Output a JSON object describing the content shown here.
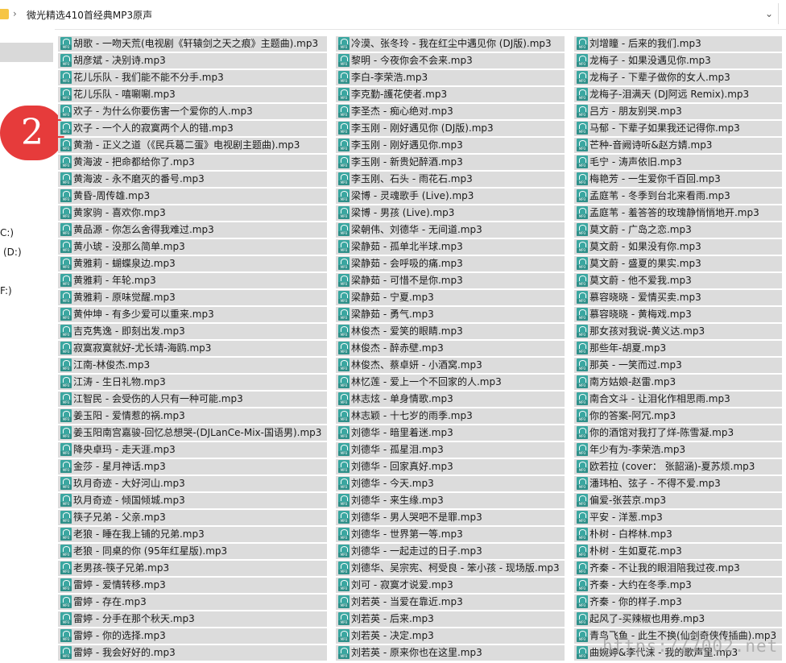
{
  "address": {
    "separator": "›",
    "path": "微光精选410首经典MP3原声",
    "dropdown": "⌄"
  },
  "nav": {
    "drives": [
      "C:)",
      "(D:)",
      "F:)"
    ]
  },
  "badge": "2",
  "file_type_label": "MP3",
  "columns": [
    [
      "胡歌 - 一吻天荒(电视剧《轩辕剑之天之痕》主题曲).mp3",
      "胡彦斌 - 决别诗.mp3",
      "花儿乐队 - 我们能不能不分手.mp3",
      "花儿乐队 - 嘻唰唰.mp3",
      "欢子 - 为什么你要伤害一个爱你的人.mp3",
      "欢子 - 一个人的寂寞两个人的错.mp3",
      "黄渤 - 正义之道（《民兵葛二蛋》电视剧主题曲).mp3",
      "黄海波 - 把命都给你了.mp3",
      "黄海波 - 永不磨灭的番号.mp3",
      "黄昏-周传雄.mp3",
      "黄家驹 - 喜欢你.mp3",
      "黄品源 - 你怎么舍得我难过.mp3",
      "黄小琥 - 没那么简单.mp3",
      "黄雅莉 - 蝴蝶泉边.mp3",
      "黄雅莉 - 年轮.mp3",
      "黄雅莉 - 原味觉醒.mp3",
      "黄仲坤 - 有多少爱可以重来.mp3",
      "吉克隽逸 - 即刻出发.mp3",
      "寂寞寂寞就好-尤长靖-海鸥.mp3",
      "江南-林俊杰.mp3",
      "江涛 - 生日礼物.mp3",
      "江智民 - 会受伤的人只有一种可能.mp3",
      "姜玉阳 - 爱情惹的祸.mp3",
      "姜玉阳南宫嘉骏-回忆总想哭-(DJLanCe-Mix-国语男).mp3",
      "降央卓玛 - 走天涯.mp3",
      "金莎 - 星月神话.mp3",
      "玖月奇迹 - 大好河山.mp3",
      "玖月奇迹 - 倾国倾城.mp3",
      "筷子兄弟 - 父亲.mp3",
      "老狼 - 睡在我上铺的兄弟.mp3",
      "老狼 - 同桌的你 (95年红星版).mp3",
      "老男孩-筷子兄弟.mp3",
      "雷婷 - 爱情转移.mp3",
      "雷婷 - 存在.mp3",
      "雷婷 - 分手在那个秋天.mp3",
      "雷婷 - 你的选择.mp3",
      "雷婷 - 我会好好的.mp3"
    ],
    [
      "冷漠、张冬玲 - 我在红尘中遇见你 (DJ版).mp3",
      "黎明 - 今夜你会不会来.mp3",
      "李白-李荣浩.mp3",
      "李克勤-護花使者.mp3",
      "李圣杰 - 痴心绝对.mp3",
      "李玉刚 - 刚好遇见你 (DJ版).mp3",
      "李玉刚 - 刚好遇见你.mp3",
      "李玉刚 - 新贵妃醉酒.mp3",
      "李玉刚、石头 - 雨花石.mp3",
      "梁博 - 灵魂歌手 (Live).mp3",
      "梁博 - 男孩 (Live).mp3",
      "梁朝伟、刘德华 - 无间道.mp3",
      "梁静茹 - 孤单北半球.mp3",
      "梁静茹 - 会呼吸的痛.mp3",
      "梁静茹 - 可惜不是你.mp3",
      "梁静茹 - 宁夏.mp3",
      "梁静茹 - 勇气.mp3",
      "林俊杰 - 爱笑的眼睛.mp3",
      "林俊杰 - 醉赤壁.mp3",
      "林俊杰、蔡卓妍 - 小酒窝.mp3",
      "林忆莲 - 爱上一个不回家的人.mp3",
      "林志炫 - 单身情歌.mp3",
      "林志颖 - 十七岁的雨季.mp3",
      "刘德华 - 暗里着迷.mp3",
      "刘德华 - 孤星泪.mp3",
      "刘德华 - 回家真好.mp3",
      "刘德华 - 今天.mp3",
      "刘德华 - 来生缘.mp3",
      "刘德华 - 男人哭吧不是罪.mp3",
      "刘德华 - 世界第一等.mp3",
      "刘德华 - 一起走过的日子.mp3",
      "刘德华、吴宗宪、柯受良 - 笨小孩 - 现场版.mp3",
      "刘可 - 寂寞才说爱.mp3",
      "刘若英 - 当爱在靠近.mp3",
      "刘若英 - 后来.mp3",
      "刘若英 - 决定.mp3",
      "刘若英 - 原来你也在这里.mp3"
    ],
    [
      "刘增瞳 - 后来的我们.mp3",
      "龙梅子 - 如果没遇见你.mp3",
      "龙梅子 - 下辈子做你的女人.mp3",
      "龙梅子-泪满天 (DJ阿远  Remix).mp3",
      "吕方 - 朋友别哭.mp3",
      "马郁 - 下辈子如果我还记得你.mp3",
      "芒种-音阙诗听&赵方婧.mp3",
      "毛宁 - 涛声依旧.mp3",
      "梅艳芳 - 一生爱你千百回.mp3",
      "孟庭苇 - 冬季到台北来看雨.mp3",
      "孟庭苇 - 羞答答的玫瑰静悄悄地开.mp3",
      "莫文蔚 - 广岛之恋.mp3",
      "莫文蔚 - 如果没有你.mp3",
      "莫文蔚 - 盛夏的果实.mp3",
      "莫文蔚 - 他不爱我.mp3",
      "慕容晓晓 - 爱情买卖.mp3",
      "慕容晓晓 - 黄梅戏.mp3",
      "那女孩对我说-黄义达.mp3",
      "那些年-胡夏.mp3",
      "那英 - 一笑而过.mp3",
      "南方姑娘-赵雷.mp3",
      "南合文斗 - 让泪化作相思雨.mp3",
      "你的答案-阿冗.mp3",
      "你的酒馆对我打了烊-陈雪凝.mp3",
      "年少有为-李荣浩.mp3",
      "欧若拉 (cover： 张韶涵)-夏苏烦.mp3",
      "潘玮柏、弦子 - 不得不爱.mp3",
      "偏爱-张芸京.mp3",
      "平安 - 洋葱.mp3",
      "朴树 - 白桦林.mp3",
      "朴树 - 生如夏花.mp3",
      "齐秦 - 不让我的眼泪陪我过夜.mp3",
      "齐秦 - 大约在冬季.mp3",
      "齐秦 - 你的样子.mp3",
      "起风了-买辣椒也用券.mp3",
      "青鸟飞鱼 - 此生不换(仙剑奇侠传插曲).mp3",
      "曲婉婷&李代沫 - 我的歌声里.mp3"
    ]
  ],
  "watermark": "https://7002.net"
}
